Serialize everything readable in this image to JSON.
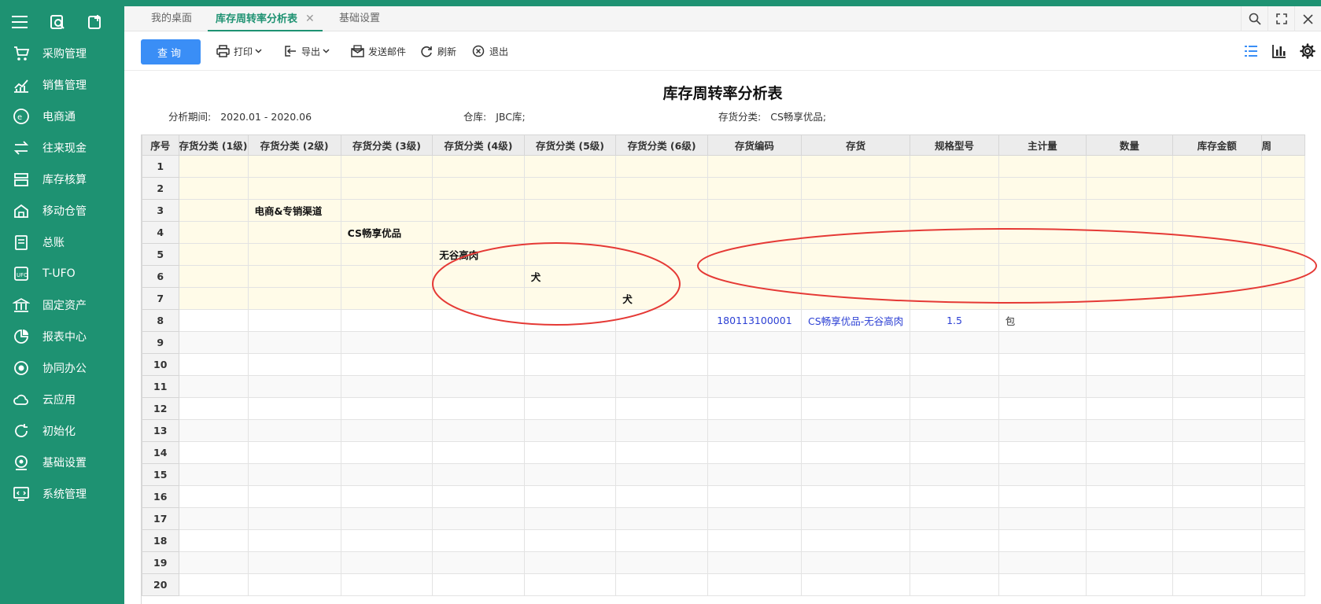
{
  "sidebar": {
    "items": [
      {
        "label": "采购管理",
        "icon": "purchase-icon"
      },
      {
        "label": "销售管理",
        "icon": "sales-icon"
      },
      {
        "label": "电商通",
        "icon": "ecommerce-icon"
      },
      {
        "label": "往来现金",
        "icon": "cash-flow-icon"
      },
      {
        "label": "库存核算",
        "icon": "inventory-icon"
      },
      {
        "label": "移动仓管",
        "icon": "mobile-warehouse-icon"
      },
      {
        "label": "总账",
        "icon": "ledger-icon"
      },
      {
        "label": "T-UFO",
        "icon": "ufo-icon"
      },
      {
        "label": "固定资产",
        "icon": "fixed-assets-icon"
      },
      {
        "label": "报表中心",
        "icon": "report-center-icon"
      },
      {
        "label": "协同办公",
        "icon": "collaboration-icon"
      },
      {
        "label": "云应用",
        "icon": "cloud-icon"
      },
      {
        "label": "初始化",
        "icon": "initialize-icon"
      },
      {
        "label": "基础设置",
        "icon": "base-settings-icon"
      },
      {
        "label": "系统管理",
        "icon": "system-manage-icon"
      }
    ]
  },
  "tabs": [
    {
      "label": "我的桌面"
    },
    {
      "label": "库存周转率分析表"
    },
    {
      "label": "基础设置"
    }
  ],
  "tab_close": "✕",
  "toolbar": {
    "query": "查询",
    "print": "打印",
    "export": "导出",
    "send_mail": "发送邮件",
    "refresh": "刷新",
    "exit": "退出"
  },
  "report": {
    "title": "库存周转率分析表",
    "filters": [
      {
        "key": "分析期间:",
        "value": "2020.01 - 2020.06"
      },
      {
        "key": "仓库:",
        "value": "JBC库;"
      },
      {
        "key": "存货分类:",
        "value": "CS畅享优品;"
      }
    ]
  },
  "table": {
    "headers": [
      "序号",
      "存货分类 (1级)",
      "存货分类 (2级)",
      "存货分类 (3级)",
      "存货分类 (4级)",
      "存货分类 (5级)",
      "存货分类 (6级)",
      "存货编码",
      "存货",
      "规格型号",
      "主计量",
      "数量",
      "库存金额",
      "周"
    ],
    "rows": [
      {
        "seq": "1",
        "cells": [
          "",
          "",
          "",
          "",
          "",
          "",
          "",
          "",
          "",
          "",
          "",
          "",
          ""
        ]
      },
      {
        "seq": "2",
        "cells": [
          "",
          "",
          "",
          "",
          "",
          "",
          "",
          "",
          "",
          "",
          "",
          "",
          ""
        ]
      },
      {
        "seq": "3",
        "cells": [
          "",
          "电商&专销渠道",
          "",
          "",
          "",
          "",
          "",
          "",
          "",
          "",
          "",
          "",
          ""
        ]
      },
      {
        "seq": "4",
        "cells": [
          "",
          "",
          "CS畅享优品",
          "",
          "",
          "",
          "",
          "",
          "",
          "",
          "",
          "",
          ""
        ]
      },
      {
        "seq": "5",
        "cells": [
          "",
          "",
          "",
          "无谷高肉",
          "",
          "",
          "",
          "",
          "",
          "",
          "",
          "",
          ""
        ]
      },
      {
        "seq": "6",
        "cells": [
          "",
          "",
          "",
          "",
          "犬",
          "",
          "",
          "",
          "",
          "",
          "",
          "",
          ""
        ]
      },
      {
        "seq": "7",
        "cells": [
          "",
          "",
          "",
          "",
          "",
          "犬",
          "",
          "",
          "",
          "",
          "",
          "",
          ""
        ]
      },
      {
        "seq": "8",
        "cells": [
          "",
          "",
          "",
          "",
          "",
          "",
          "180113100001",
          "CS畅享优品-无谷高肉",
          "1.5",
          "包",
          "",
          "",
          ""
        ]
      },
      {
        "seq": "9",
        "cells": [
          "",
          "",
          "",
          "",
          "",
          "",
          "",
          "",
          "",
          "",
          "",
          "",
          ""
        ]
      },
      {
        "seq": "10",
        "cells": [
          "",
          "",
          "",
          "",
          "",
          "",
          "",
          "",
          "",
          "",
          "",
          "",
          ""
        ]
      },
      {
        "seq": "11",
        "cells": [
          "",
          "",
          "",
          "",
          "",
          "",
          "",
          "",
          "",
          "",
          "",
          "",
          ""
        ]
      },
      {
        "seq": "12",
        "cells": [
          "",
          "",
          "",
          "",
          "",
          "",
          "",
          "",
          "",
          "",
          "",
          "",
          ""
        ]
      },
      {
        "seq": "13",
        "cells": [
          "",
          "",
          "",
          "",
          "",
          "",
          "",
          "",
          "",
          "",
          "",
          "",
          ""
        ]
      },
      {
        "seq": "14",
        "cells": [
          "",
          "",
          "",
          "",
          "",
          "",
          "",
          "",
          "",
          "",
          "",
          "",
          ""
        ]
      },
      {
        "seq": "15",
        "cells": [
          "",
          "",
          "",
          "",
          "",
          "",
          "",
          "",
          "",
          "",
          "",
          "",
          ""
        ]
      },
      {
        "seq": "16",
        "cells": [
          "",
          "",
          "",
          "",
          "",
          "",
          "",
          "",
          "",
          "",
          "",
          "",
          ""
        ]
      },
      {
        "seq": "17",
        "cells": [
          "",
          "",
          "",
          "",
          "",
          "",
          "",
          "",
          "",
          "",
          "",
          "",
          ""
        ]
      },
      {
        "seq": "18",
        "cells": [
          "",
          "",
          "",
          "",
          "",
          "",
          "",
          "",
          "",
          "",
          "",
          "",
          ""
        ]
      },
      {
        "seq": "19",
        "cells": [
          "",
          "",
          "",
          "",
          "",
          "",
          "",
          "",
          "",
          "",
          "",
          "",
          ""
        ]
      },
      {
        "seq": "20",
        "cells": [
          "",
          "",
          "",
          "",
          "",
          "",
          "",
          "",
          "",
          "",
          "",
          "",
          ""
        ]
      }
    ]
  },
  "colors": {
    "brand": "#1e9272",
    "query_button": "#3a8ef6",
    "annotation": "#e53935",
    "subtotal_row": "#fffbe8",
    "link_text": "#2b3fd4"
  }
}
